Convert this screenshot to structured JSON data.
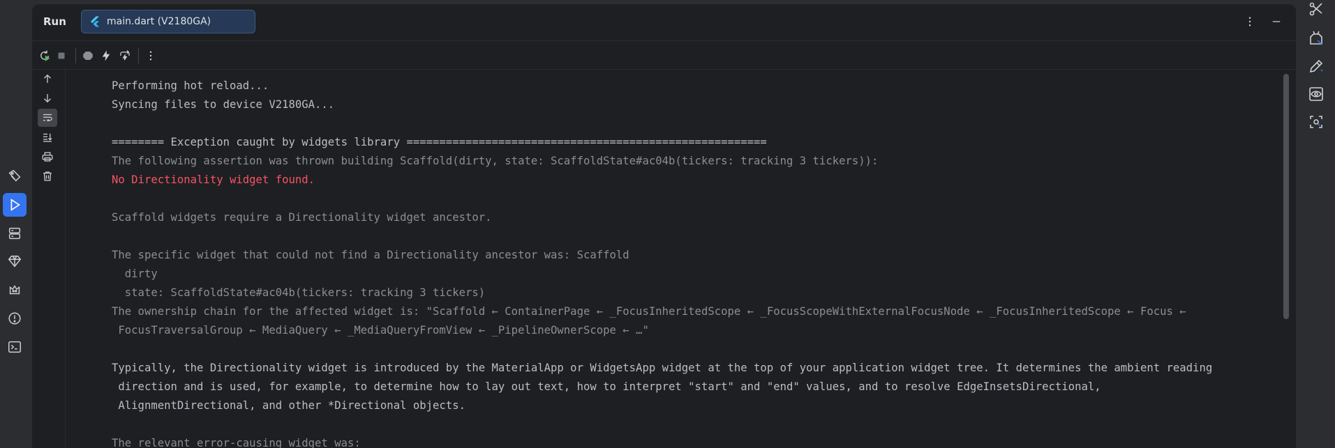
{
  "header": {
    "title": "Run",
    "tab_label": "main.dart (V2180GA)"
  },
  "console": {
    "lines": [
      {
        "text": "Performing hot reload...",
        "style": "normal"
      },
      {
        "text": "Syncing files to device V2180GA...",
        "style": "normal"
      },
      {
        "text": "",
        "style": "normal"
      },
      {
        "text": "======== Exception caught by widgets library =======================================================",
        "style": "normal"
      },
      {
        "text": "The following assertion was thrown building Scaffold(dirty, state: ScaffoldState#ac04b(tickers: tracking 3 tickers)):",
        "style": "gray"
      },
      {
        "text": "No Directionality widget found.",
        "style": "err"
      },
      {
        "text": "",
        "style": "normal"
      },
      {
        "text": "Scaffold widgets require a Directionality widget ancestor.",
        "style": "gray"
      },
      {
        "text": "",
        "style": "normal"
      },
      {
        "text": "The specific widget that could not find a Directionality ancestor was: Scaffold",
        "style": "gray"
      },
      {
        "text": "  dirty",
        "style": "gray"
      },
      {
        "text": "  state: ScaffoldState#ac04b(tickers: tracking 3 tickers)",
        "style": "gray"
      },
      {
        "text": "The ownership chain for the affected widget is: \"Scaffold ← ContainerPage ← _FocusInheritedScope ← _FocusScopeWithExternalFocusNode ← _FocusInheritedScope ← Focus ←",
        "style": "gray"
      },
      {
        "text": " FocusTraversalGroup ← MediaQuery ← _MediaQueryFromView ← _PipelineOwnerScope ← …\"",
        "style": "gray"
      },
      {
        "text": "",
        "style": "normal"
      },
      {
        "text": "Typically, the Directionality widget is introduced by the MaterialApp or WidgetsApp widget at the top of your application widget tree. It determines the ambient reading",
        "style": "normal"
      },
      {
        "text": " direction and is used, for example, to determine how to lay out text, how to interpret \"start\" and \"end\" values, and to resolve EdgeInsetsDirectional,",
        "style": "normal"
      },
      {
        "text": " AlignmentDirectional, and other *Directional objects.",
        "style": "normal"
      },
      {
        "text": "",
        "style": "normal"
      },
      {
        "text": "The relevant error-causing widget was:",
        "style": "gray"
      }
    ]
  },
  "colors": {
    "accent": "#3574f0",
    "error": "#f75464",
    "background": "#1e1f22",
    "text": "#bcbec4",
    "dim_text": "#8c8e93"
  }
}
